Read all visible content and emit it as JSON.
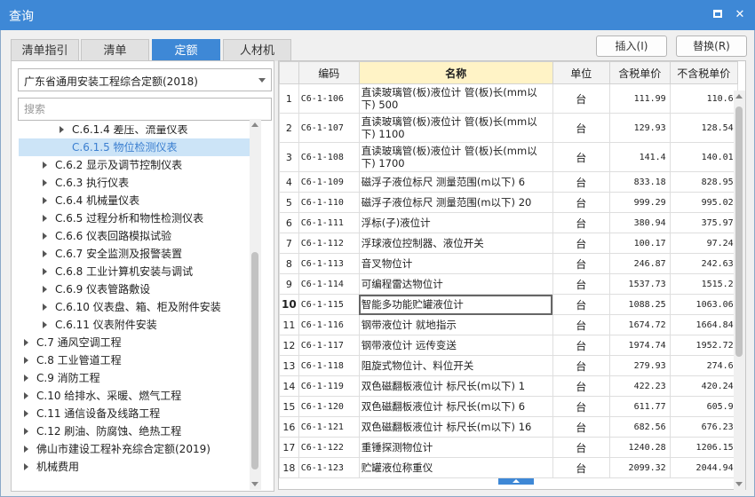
{
  "window": {
    "title": "查询",
    "maximize_icon": "maximize-icon",
    "close_icon": "close-icon",
    "close_glyph": "✕"
  },
  "tabs": [
    {
      "label": "清单指引"
    },
    {
      "label": "清单"
    },
    {
      "label": "定额",
      "active": true
    },
    {
      "label": "人材机"
    }
  ],
  "buttons": {
    "insert": "插入(I)",
    "replace": "替换(R)"
  },
  "left": {
    "dropdown_value": "广东省通用安装工程综合定额(2018)",
    "search_placeholder": "搜索",
    "tree": [
      {
        "label": "C.6.1.4 差压、流量仪表",
        "has_children": true
      },
      {
        "label": "C.6.1.5 物位检测仪表",
        "has_children": false,
        "selected": true
      },
      {
        "label": "C.6.2 显示及调节控制仪表",
        "has_children": true
      },
      {
        "label": "C.6.3 执行仪表",
        "has_children": true
      },
      {
        "label": "C.6.4 机械量仪表",
        "has_children": true
      },
      {
        "label": "C.6.5 过程分析和物性检测仪表",
        "has_children": true
      },
      {
        "label": "C.6.6 仪表回路模拟试验",
        "has_children": true
      },
      {
        "label": "C.6.7 安全监测及报警装置",
        "has_children": true
      },
      {
        "label": "C.6.8 工业计算机安装与调试",
        "has_children": true
      },
      {
        "label": "C.6.9 仪表管路敷设",
        "has_children": true
      },
      {
        "label": "C.6.10 仪表盘、箱、柜及附件安装",
        "has_children": true
      },
      {
        "label": "C.6.11 仪表附件安装",
        "has_children": true
      },
      {
        "label": "C.7 通风空调工程",
        "has_children": true
      },
      {
        "label": "C.8 工业管道工程",
        "has_children": true
      },
      {
        "label": "C.9 消防工程",
        "has_children": true
      },
      {
        "label": "C.10 给排水、采暖、燃气工程",
        "has_children": true
      },
      {
        "label": "C.11 通信设备及线路工程",
        "has_children": true
      },
      {
        "label": "C.12 刷油、防腐蚀、绝热工程",
        "has_children": true
      },
      {
        "label": "佛山市建设工程补充综合定额(2019)",
        "has_children": true
      },
      {
        "label": "机械费用",
        "has_children": true
      }
    ]
  },
  "table": {
    "columns": [
      "",
      "编码",
      "名称",
      "单位",
      "含税单价",
      "不含税单价"
    ],
    "current_row": 10,
    "rows": [
      {
        "no": "1",
        "code": "C6-1-106",
        "name": "直读玻璃管(板)液位计 管(板)长(mm以下) 500",
        "unit": "台",
        "price_tax": "111.99",
        "price_notax": "110.6"
      },
      {
        "no": "2",
        "code": "C6-1-107",
        "name": "直读玻璃管(板)液位计 管(板)长(mm以下) 1100",
        "unit": "台",
        "price_tax": "129.93",
        "price_notax": "128.54"
      },
      {
        "no": "3",
        "code": "C6-1-108",
        "name": "直读玻璃管(板)液位计 管(板)长(mm以下) 1700",
        "unit": "台",
        "price_tax": "141.4",
        "price_notax": "140.01"
      },
      {
        "no": "4",
        "code": "C6-1-109",
        "name": "磁浮子液位标尺 测量范围(m以下) 6",
        "unit": "台",
        "price_tax": "833.18",
        "price_notax": "828.95"
      },
      {
        "no": "5",
        "code": "C6-1-110",
        "name": "磁浮子液位标尺 测量范围(m以下) 20",
        "unit": "台",
        "price_tax": "999.29",
        "price_notax": "995.02"
      },
      {
        "no": "6",
        "code": "C6-1-111",
        "name": "浮标(子)液位计",
        "unit": "台",
        "price_tax": "380.94",
        "price_notax": "375.97"
      },
      {
        "no": "7",
        "code": "C6-1-112",
        "name": "浮球液位控制器、液位开关",
        "unit": "台",
        "price_tax": "100.17",
        "price_notax": "97.24"
      },
      {
        "no": "8",
        "code": "C6-1-113",
        "name": "音叉物位计",
        "unit": "台",
        "price_tax": "246.87",
        "price_notax": "242.63"
      },
      {
        "no": "9",
        "code": "C6-1-114",
        "name": "可编程雷达物位计",
        "unit": "台",
        "price_tax": "1537.73",
        "price_notax": "1515.2"
      },
      {
        "no": "10",
        "code": "C6-1-115",
        "name": "智能多功能贮罐液位计",
        "unit": "台",
        "price_tax": "1088.25",
        "price_notax": "1063.06"
      },
      {
        "no": "11",
        "code": "C6-1-116",
        "name": "钢带液位计 就地指示",
        "unit": "台",
        "price_tax": "1674.72",
        "price_notax": "1664.84"
      },
      {
        "no": "12",
        "code": "C6-1-117",
        "name": "钢带液位计 远传变送",
        "unit": "台",
        "price_tax": "1974.74",
        "price_notax": "1952.72"
      },
      {
        "no": "13",
        "code": "C6-1-118",
        "name": "阻旋式物位计、料位开关",
        "unit": "台",
        "price_tax": "279.93",
        "price_notax": "274.6"
      },
      {
        "no": "14",
        "code": "C6-1-119",
        "name": "双色磁翻板液位计 标尺长(m以下) 1",
        "unit": "台",
        "price_tax": "422.23",
        "price_notax": "420.24"
      },
      {
        "no": "15",
        "code": "C6-1-120",
        "name": "双色磁翻板液位计 标尺长(m以下) 6",
        "unit": "台",
        "price_tax": "611.77",
        "price_notax": "605.9"
      },
      {
        "no": "16",
        "code": "C6-1-121",
        "name": "双色磁翻板液位计 标尺长(m以下) 16",
        "unit": "台",
        "price_tax": "682.56",
        "price_notax": "676.23"
      },
      {
        "no": "17",
        "code": "C6-1-122",
        "name": "重锤探测物位计",
        "unit": "台",
        "price_tax": "1240.28",
        "price_notax": "1206.15"
      },
      {
        "no": "18",
        "code": "C6-1-123",
        "name": "贮罐液位称重仪",
        "unit": "台",
        "price_tax": "2099.32",
        "price_notax": "2044.94"
      }
    ]
  }
}
